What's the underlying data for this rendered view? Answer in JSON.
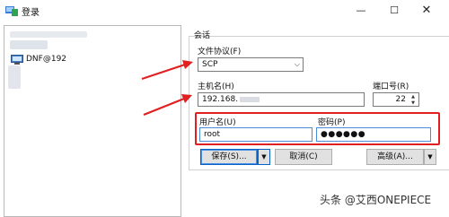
{
  "window": {
    "title": "登录",
    "min_glyph": "—",
    "max_glyph": "☐",
    "close_glyph": "✕"
  },
  "site_tree": {
    "items": [
      {
        "label": "DNF@192",
        "icon": "computer-icon"
      }
    ]
  },
  "session": {
    "group_label": "会话",
    "protocol_label": "文件协议(F)",
    "protocol_value": "SCP",
    "host_label": "主机名(H)",
    "host_value": "192.168.",
    "port_label": "端口号(R)",
    "port_value": "22",
    "user_label": "用户名(U)",
    "user_value": "root",
    "password_label": "密码(P)",
    "password_value": "●●●●●●"
  },
  "buttons": {
    "save": "保存(S)...",
    "cancel": "取消(C)",
    "advanced": "高级(A)..."
  },
  "watermark": "头条 @艾西ONEPIECE",
  "colors": {
    "highlight": "#e02020",
    "focus": "#4a8fd6"
  }
}
